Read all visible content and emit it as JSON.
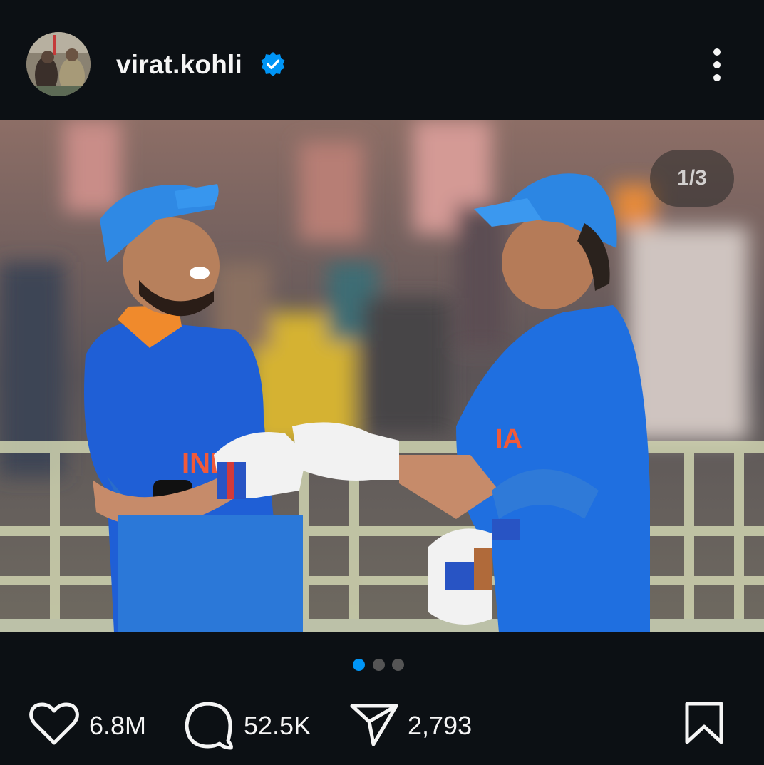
{
  "post": {
    "username": "virat.kohli",
    "verified": true,
    "icons": {
      "verified": "verified-badge-icon",
      "more": "more-vertical-icon",
      "like": "heart-icon",
      "comment": "comment-bubble-icon",
      "share": "paper-plane-icon",
      "save": "bookmark-icon"
    },
    "media": {
      "counter": "1/3",
      "current_index": 1,
      "total": 3
    },
    "stats": {
      "likes": "6.8M",
      "comments": "52.5K",
      "shares": "2,793"
    }
  },
  "colors": {
    "background": "#0c1014",
    "text": "#f5f5f5",
    "accent": "#0095f6",
    "dot_inactive": "#555555"
  }
}
